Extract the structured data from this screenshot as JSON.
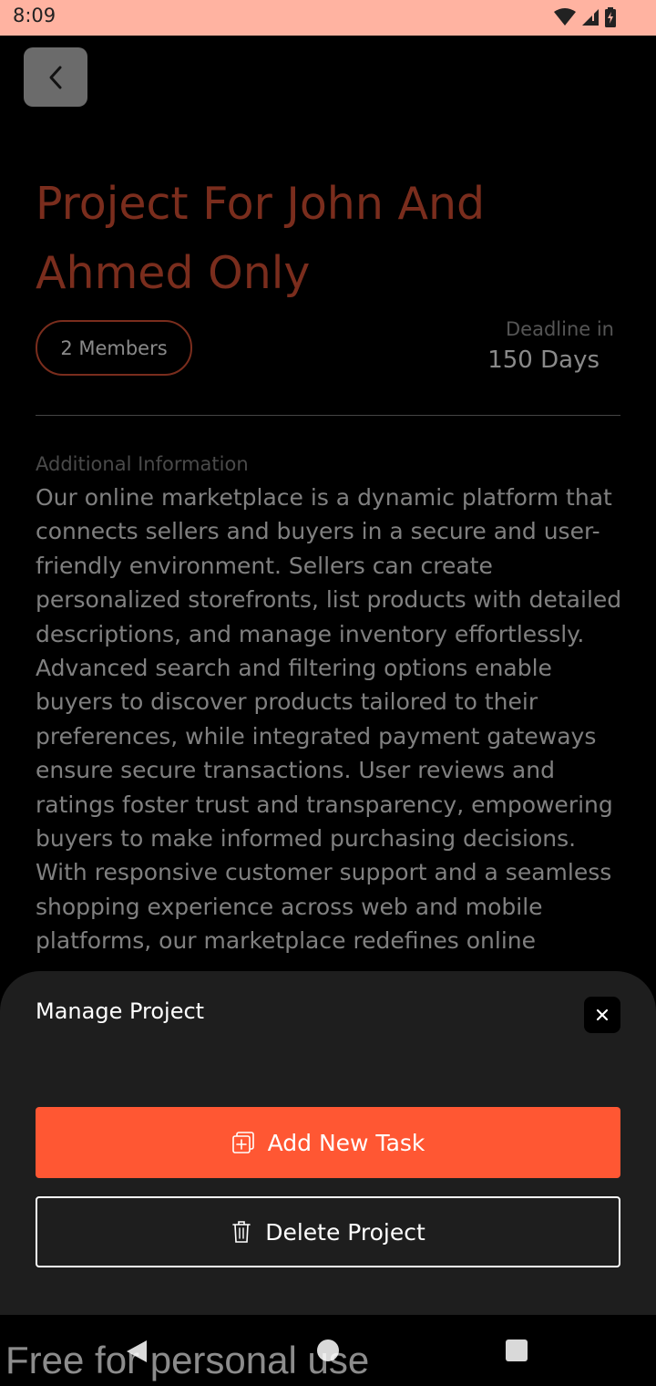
{
  "status_bar": {
    "time": "8:09",
    "icons": [
      "wifi-icon",
      "signal-icon",
      "battery-icon"
    ],
    "background": "#ffb3a1"
  },
  "project": {
    "title": "Project For John And Ahmed Only",
    "members": "2 Members",
    "deadline_label": "Deadline in",
    "deadline_value": "150 Days",
    "info_label": "Additional Information",
    "info_text": "Our online marketplace is a dynamic platform that connects sellers and buyers in a secure and user-friendly environment. Sellers can create personalized storefronts, list products with detailed descriptions, and manage inventory effortlessly. Advanced search and filtering options enable buyers to discover products tailored to their preferences, while integrated payment gateways ensure secure transactions. User reviews and ratings foster trust and transparency, empowering buyers to make informed purchasing decisions. With responsive customer support and a seamless shopping experience across web and mobile platforms, our marketplace redefines online"
  },
  "sheet": {
    "title": "Manage Project",
    "add_task_label": "Add New Task",
    "delete_label": "Delete Project"
  },
  "colors": {
    "accent": "#ff5733",
    "title": "#7a2d1d",
    "sheet_bg": "#1e1e1e"
  },
  "watermark": "Free for personal use"
}
